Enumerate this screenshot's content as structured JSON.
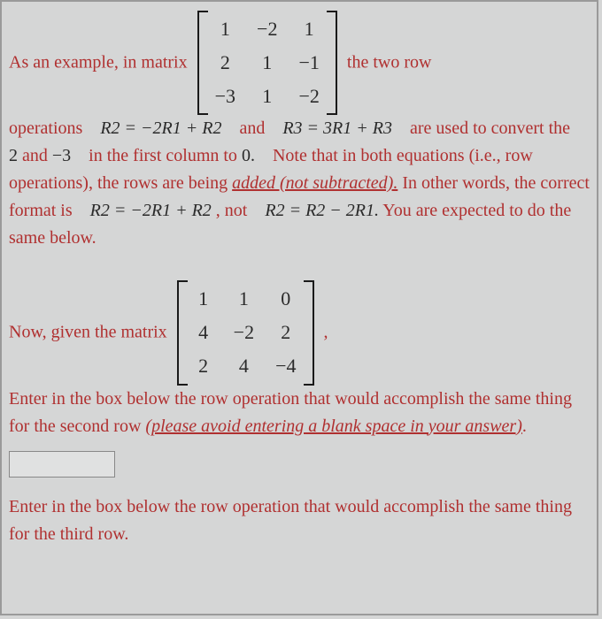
{
  "para1": {
    "t1": "As an example, in matrix",
    "t2": "the two row",
    "t3": "operations",
    "op1": "R2 = −2R1 + R2",
    "t4": "and",
    "op2": "R3 = 3R1 + R3",
    "t5": "are",
    "t6": "used to convert the",
    "n2": "2",
    "t7": "and",
    "n3": "−3",
    "t8": "in the first column to",
    "n0": "0.",
    "t9": "Note that in both equations (i.e., row operations), the rows are being ",
    "u1": "added (not subtracted).",
    "t10": " In other words, the correct format is",
    "op3": "R2 = −2R1 + R2",
    "t11": ", not",
    "op4": "R2 = R2 − 2R1.",
    "t12": "You are expected to do the same below."
  },
  "matrix1": {
    "r1c1": "1",
    "r1c2": "−2",
    "r1c3": "1",
    "r2c1": "2",
    "r2c2": "1",
    "r2c3": "−1",
    "r3c1": "−3",
    "r3c2": "1",
    "r3c3": "−2"
  },
  "para2": {
    "t1": "Now, given the matrix",
    "t2": ",",
    "t3": "Enter in the box below the row operation that would accomplish the same thing for the second row ",
    "u1": "(please avoid entering a blank space in your answer)",
    "t4": "."
  },
  "matrix2": {
    "r1c1": "1",
    "r1c2": "1",
    "r1c3": "0",
    "r2c1": "4",
    "r2c2": "−2",
    "r2c3": "2",
    "r3c1": "2",
    "r3c2": "4",
    "r3c3": "−4"
  },
  "para3": {
    "t1": "Enter in the box below the row operation that would accomplish the same thing for the third row."
  },
  "colors": {
    "red": "#b03030"
  }
}
